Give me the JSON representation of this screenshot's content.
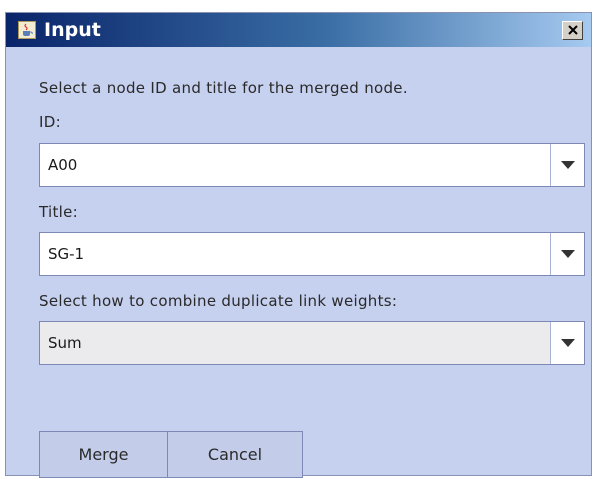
{
  "window": {
    "title": "Input",
    "close_label": "×"
  },
  "dialog": {
    "prompt": "Select a node ID and title for the merged node.",
    "id_label": "ID:",
    "id_value": "A00",
    "title_label": "Title:",
    "title_value": "SG-1",
    "combine_label": "Select how to combine duplicate link weights:",
    "combine_value": "Sum"
  },
  "buttons": {
    "merge_label": "Merge",
    "cancel_label": "Cancel"
  },
  "icons": {
    "app": "java-cup-icon",
    "close": "close-icon",
    "dropdown": "chevron-down-icon"
  },
  "colors": {
    "titlebar_start": "#0a246a",
    "titlebar_end": "#a6caf0",
    "dialog_background": "#c6d0ef"
  }
}
